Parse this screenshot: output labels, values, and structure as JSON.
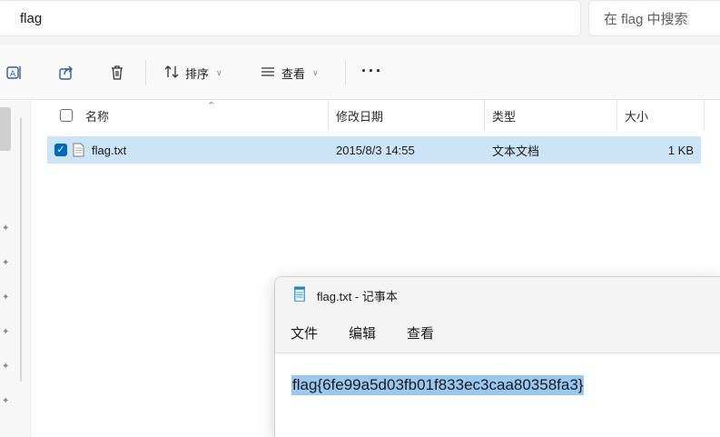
{
  "address": {
    "path": "flag"
  },
  "search": {
    "placeholder": "在 flag 中搜索"
  },
  "toolbar": {
    "sort_label": "排序",
    "view_label": "查看",
    "more_label": "···"
  },
  "file_list": {
    "columns": [
      "名称",
      "修改日期",
      "类型",
      "大小"
    ],
    "rows": [
      {
        "name": "flag.txt",
        "modified": "2015/8/3 14:55",
        "type": "文本文档",
        "size": "1 KB",
        "selected": true
      }
    ]
  },
  "notepad": {
    "title": "flag.txt - 记事本",
    "menu": [
      "文件",
      "编辑",
      "查看"
    ],
    "content": "flag{6fe99a5d03fb01f833ec3caa80358fa3}"
  },
  "colors": {
    "selection": "#cce4f7",
    "accent": "#0067c0",
    "text_highlight": "#99c9f0"
  }
}
